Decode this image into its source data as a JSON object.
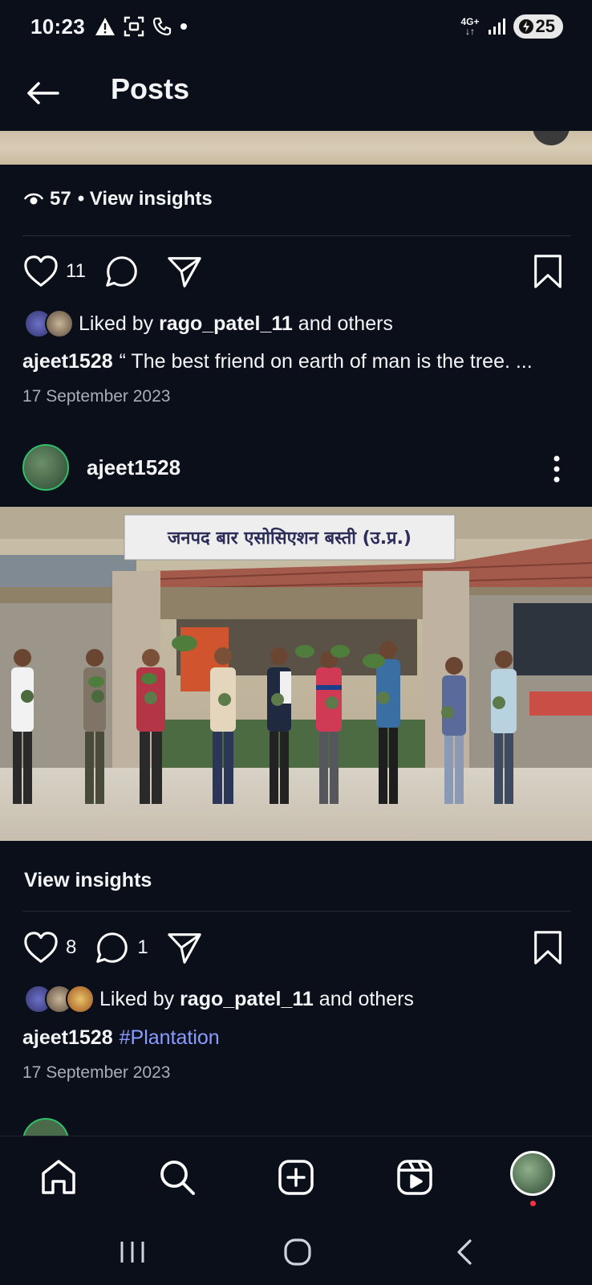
{
  "status_bar": {
    "time": "10:23",
    "network": "4G+",
    "battery": "25"
  },
  "header": {
    "back_icon": "arrow-left-icon",
    "title": "Posts"
  },
  "previous_post": {
    "views": "57",
    "view_insights_label": "• View insights",
    "like_count": "11",
    "liked_by_prefix": "Liked by",
    "liked_by_user": "rago_patel_11",
    "liked_by_suffix": "and others",
    "caption_user": "ajeet1528",
    "caption_text": "“ The best friend on earth of man is the tree. ...",
    "date": "17 September 2023"
  },
  "post": {
    "username": "ajeet1528",
    "sign_text": "जनपद बार एसोसिएशन बस्ती (उ.प्र.)",
    "view_insights_label": "View insights",
    "like_count": "8",
    "comment_count": "1",
    "liked_by_prefix": "Liked by",
    "liked_by_user": "rago_patel_11",
    "liked_by_suffix": "and others",
    "caption_user": "ajeet1528",
    "caption_tag": "#Plantation",
    "date": "17 September 2023"
  },
  "bottom_nav": {
    "items": [
      "home-icon",
      "search-icon",
      "create-post-icon",
      "reels-icon",
      "profile-avatar"
    ]
  },
  "colors": {
    "background": "#0b0f19",
    "hashtag": "#8a9cff",
    "notification_dot": "#ff3040"
  }
}
